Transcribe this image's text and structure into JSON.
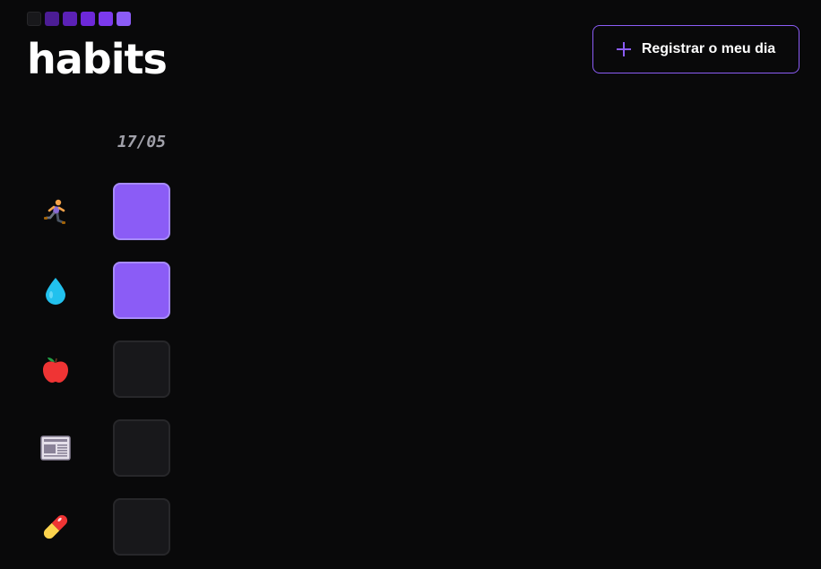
{
  "app": {
    "logo_text": "habits",
    "logo_squares": [
      "#18181b",
      "#4c1d95",
      "#5b21b6",
      "#6d28d9",
      "#7c3aed",
      "#8b5cf6"
    ]
  },
  "header": {
    "new_habit_button_label": "Registrar o meu dia",
    "new_habit_button_icon": "plus-icon"
  },
  "summary": {
    "date": "17/05",
    "habits": [
      {
        "icon": "running-person-icon",
        "completed": true
      },
      {
        "icon": "water-drop-icon",
        "completed": true
      },
      {
        "icon": "apple-icon",
        "completed": false
      },
      {
        "icon": "newspaper-icon",
        "completed": false
      },
      {
        "icon": "pill-icon",
        "completed": false
      }
    ]
  },
  "colors": {
    "accent": "#8b5cf6",
    "cell_done": "#8b5cf6",
    "cell_empty": "#18181b",
    "background": "#09090a"
  }
}
